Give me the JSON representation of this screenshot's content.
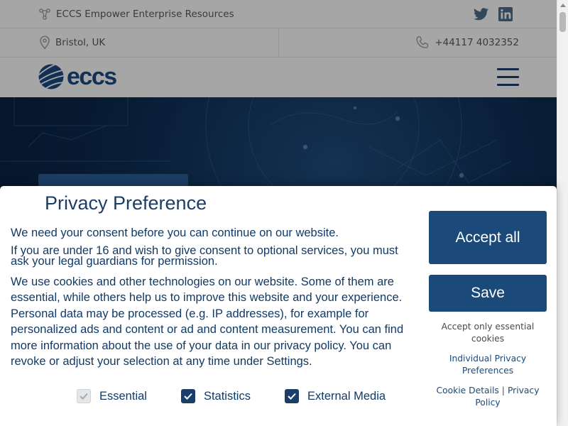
{
  "topbar": {
    "tagline": "ECCS Empower Enterprise Resources",
    "social": [
      {
        "icon": "twitter-icon"
      },
      {
        "icon": "linkedin-icon"
      }
    ]
  },
  "infobar": {
    "location": "Bristol, UK",
    "phone": "+44117 4032352"
  },
  "header": {
    "logo_text": "eccs"
  },
  "modal": {
    "title": "Privacy Preference",
    "paragraph1": "We need your consent before you can continue on our website.",
    "paragraph2": "If you are under 16 and wish to give consent to optional services, you must ask your legal guardians for permission.",
    "paragraph3": "We use cookies and other technologies on our website. Some of them are essential, while others help us to improve this website and your experience. Personal data may be processed (e.g. IP addresses), for example for personalized ads and content or ad and content measurement. You can find more information about the use of your data in our privacy policy. You can revoke or adjust your selection at any time under Settings.",
    "checkboxes": [
      {
        "label": "Essential",
        "checked": true,
        "disabled": true
      },
      {
        "label": "Statistics",
        "checked": true,
        "disabled": false
      },
      {
        "label": "External Media",
        "checked": true,
        "disabled": false
      }
    ],
    "accept_all": "Accept all",
    "save": "Save",
    "accept_essential": "Accept only essential cookies",
    "individual": "Individual Privacy Preferences",
    "cookie_details": "Cookie Details",
    "separator": "|",
    "privacy_policy": "Privacy Policy"
  },
  "colors": {
    "brand": "#1b4a7a",
    "text": "#123a66",
    "hero_dark": "#0d2c52"
  }
}
